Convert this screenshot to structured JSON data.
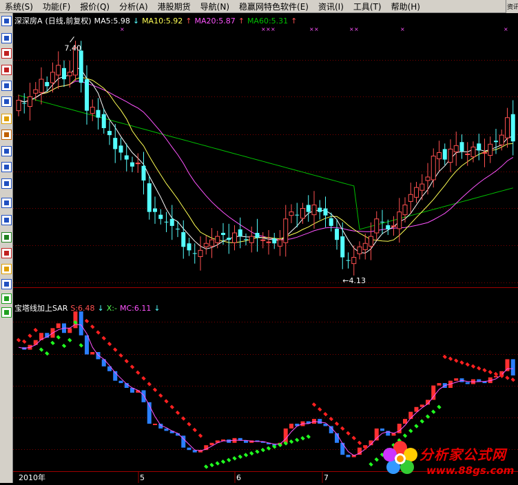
{
  "menu": [
    "系统(S)",
    "功能(F)",
    "报价(Q)",
    "分析(A)",
    "港股期货",
    "导航(N)",
    "稳赢网特色软件(E)",
    "资讯(I)",
    "工具(T)",
    "帮助(H)"
  ],
  "right_button": "资讯",
  "toolbar_icons": [
    "window-icon",
    "list-icon",
    "trend-icon",
    "kline-icon",
    "table-icon",
    "report-icon",
    "mail-icon",
    "people-icon",
    "fx-icon",
    "zoom-icon",
    "elt-icon",
    "wave-icon",
    "rsi-icon",
    "grid-icon",
    "money-icon",
    "pencil-icon",
    "move-icon",
    "arrow-up-icon",
    "arrow-down-icon"
  ],
  "main_header": {
    "stock": "深深房A",
    "period": "(日线,前复权)",
    "ma5": "MA5:5.98",
    "ma10": "MA10:5.92",
    "ma20": "MA20:5.87",
    "ma60": "MA60:5.31",
    "up_arrow": "↑",
    "down_arrow": "↓"
  },
  "annotations": {
    "high": "7.40",
    "low": "←4.13"
  },
  "sub_header": {
    "name": "宝塔线加上SAR",
    "s": "S:6.48",
    "x": "X:-",
    "mc": "MC:6.11",
    "down_arrow": "↓"
  },
  "x_axis": {
    "year": "2010年",
    "months": [
      "5",
      "6",
      "7"
    ]
  },
  "logo": {
    "line1": "分析家公式网",
    "line2": "www.88gs.com"
  },
  "colors": {
    "up": "#ff5050",
    "down": "#54ffff",
    "ma5": "#ffffff",
    "ma10": "#ffff54",
    "ma20": "#ff54ff",
    "ma60": "#00c000",
    "grid": "#800000",
    "sar_up": "#ff2020",
    "sar_down": "#20ff20",
    "tower_down": "#2a7fff",
    "tower_up": "#ff3030",
    "mc_line": "#ff54ff"
  },
  "chart_data": {
    "type": "candlestick",
    "title": "深深房A (日线,前复权)",
    "period": "daily",
    "price_range": [
      4.13,
      7.4
    ],
    "high_label": 7.4,
    "low_label": 4.13,
    "ma_last": {
      "MA5": 5.98,
      "MA10": 5.92,
      "MA20": 5.87,
      "MA60": 5.31
    },
    "sub_indicator": {
      "name": "宝塔线加上SAR",
      "S": 6.48,
      "X": null,
      "MC": 6.11
    },
    "closes": [
      6.55,
      6.5,
      6.6,
      6.7,
      6.85,
      6.75,
      6.95,
      7.05,
      6.85,
      6.95,
      7.3,
      6.8,
      6.4,
      6.45,
      6.3,
      6.15,
      6.05,
      5.85,
      5.8,
      5.7,
      5.6,
      5.65,
      5.4,
      4.95,
      4.95,
      4.85,
      4.8,
      4.75,
      4.7,
      4.45,
      4.4,
      4.35,
      4.4,
      4.5,
      4.55,
      4.6,
      4.62,
      4.55,
      4.65,
      4.6,
      4.55,
      4.6,
      4.58,
      4.55,
      4.52,
      4.5,
      4.55,
      4.85,
      4.95,
      4.9,
      5.0,
      4.95,
      5.05,
      4.95,
      4.9,
      4.75,
      4.55,
      4.3,
      4.25,
      4.3,
      4.45,
      4.5,
      4.6,
      4.85,
      4.8,
      4.7,
      4.75,
      4.95,
      5.05,
      5.2,
      5.3,
      5.35,
      5.45,
      5.75,
      5.8,
      5.7,
      5.85,
      5.9,
      5.82,
      5.78,
      5.88,
      5.83,
      5.8,
      5.92,
      5.95,
      6.05,
      6.3,
      5.96
    ]
  }
}
